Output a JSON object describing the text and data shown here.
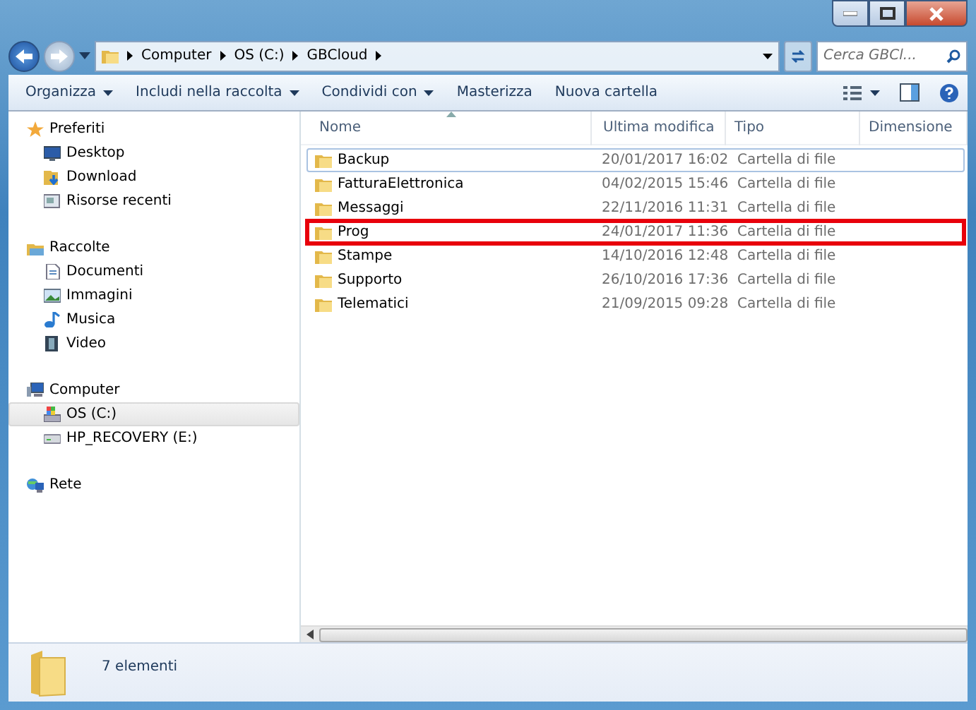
{
  "address": {
    "crumbs": [
      "Computer",
      "OS (C:)",
      "GBCloud"
    ]
  },
  "search": {
    "placeholder": "Cerca GBCl..."
  },
  "toolbar": [
    {
      "label": "Organizza",
      "dropdown": true
    },
    {
      "label": "Includi nella raccolta",
      "dropdown": true
    },
    {
      "label": "Condividi con",
      "dropdown": true
    },
    {
      "label": "Masterizza",
      "dropdown": false
    },
    {
      "label": "Nuova cartella",
      "dropdown": false
    }
  ],
  "sidebar": {
    "groups": [
      {
        "label": "Preferiti",
        "selected": false,
        "children": [
          {
            "label": "Desktop",
            "selected": false
          },
          {
            "label": "Download",
            "selected": false
          },
          {
            "label": "Risorse recenti",
            "selected": false
          }
        ]
      },
      {
        "label": "Raccolte",
        "selected": false,
        "children": [
          {
            "label": "Documenti",
            "selected": false
          },
          {
            "label": "Immagini",
            "selected": false
          },
          {
            "label": "Musica",
            "selected": false
          },
          {
            "label": "Video",
            "selected": false
          }
        ]
      },
      {
        "label": "Computer",
        "selected": false,
        "children": [
          {
            "label": "OS (C:)",
            "selected": true
          },
          {
            "label": "HP_RECOVERY (E:)",
            "selected": false
          }
        ]
      },
      {
        "label": "Rete",
        "selected": false
      }
    ]
  },
  "table": {
    "columns": [
      {
        "label": "Nome",
        "sorted": true
      },
      {
        "label": "Ultima modifica",
        "sorted": false
      },
      {
        "label": "Tipo",
        "sorted": false
      },
      {
        "label": "Dimensione",
        "sorted": false
      }
    ],
    "rows": [
      {
        "name": "Backup",
        "modified": "20/01/2017 16:02",
        "type": "Cartella di file",
        "focused": true,
        "highlighted": false
      },
      {
        "name": "FatturaElettronica",
        "modified": "04/02/2015 15:46",
        "type": "Cartella di file",
        "focused": false,
        "highlighted": false
      },
      {
        "name": "Messaggi",
        "modified": "22/11/2016 11:31",
        "type": "Cartella di file",
        "focused": false,
        "highlighted": false
      },
      {
        "name": "Prog",
        "modified": "24/01/2017 11:36",
        "type": "Cartella di file",
        "focused": false,
        "highlighted": true
      },
      {
        "name": "Stampe",
        "modified": "14/10/2016 12:48",
        "type": "Cartella di file",
        "focused": false,
        "highlighted": false
      },
      {
        "name": "Supporto",
        "modified": "26/10/2016 17:36",
        "type": "Cartella di file",
        "focused": false,
        "highlighted": false
      },
      {
        "name": "Telematici",
        "modified": "21/09/2015 09:28",
        "type": "Cartella di file",
        "focused": false,
        "highlighted": false
      }
    ]
  },
  "status_bar": {
    "text": "7 elementi"
  }
}
